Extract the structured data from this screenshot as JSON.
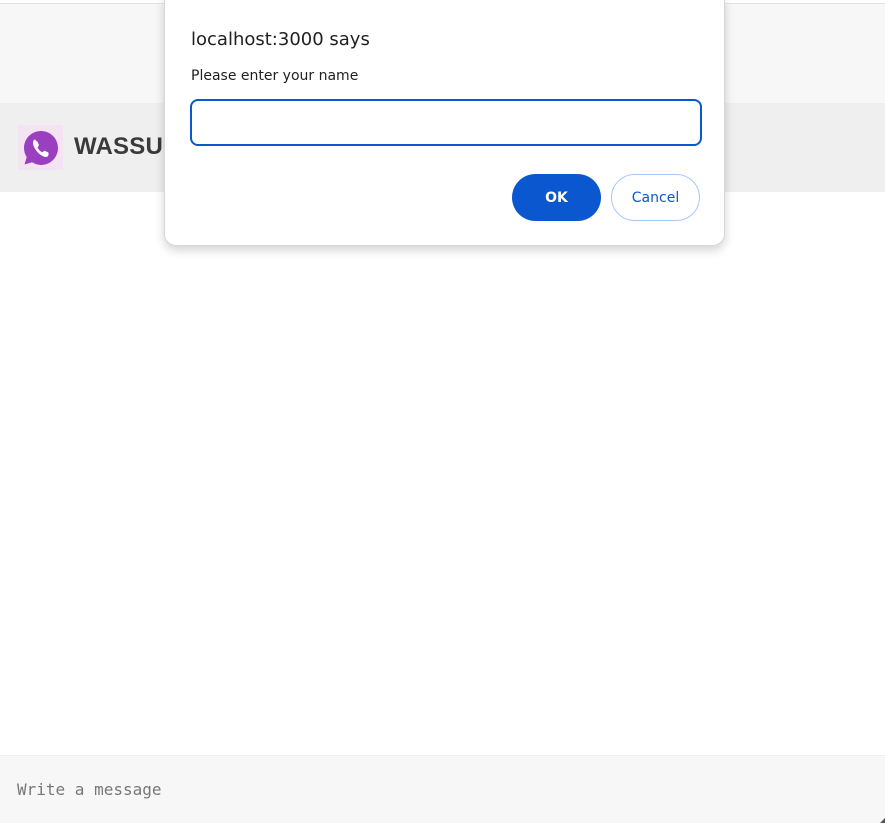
{
  "app": {
    "title": "WASSUP",
    "logo_icon": "phone-chat-icon",
    "brand_color": "#9a3fc0"
  },
  "dialog": {
    "title": "localhost:3000 says",
    "message": "Please enter your name",
    "input_value": "",
    "ok_label": "OK",
    "cancel_label": "Cancel",
    "accent_color": "#0b57d0"
  },
  "composer": {
    "placeholder": "Write a message"
  }
}
